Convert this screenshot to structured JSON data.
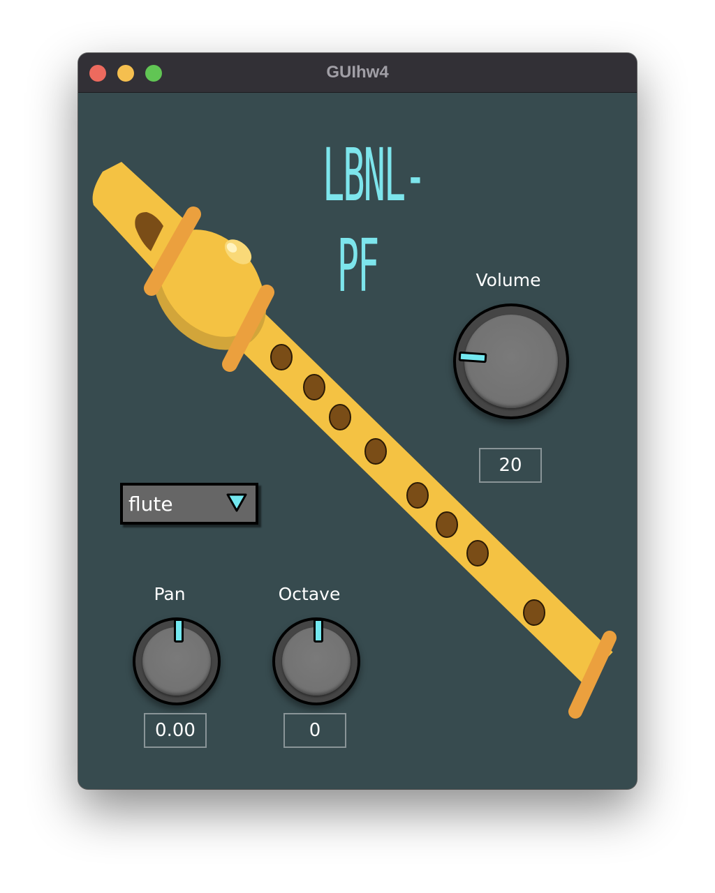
{
  "window": {
    "title": "GUIhw4"
  },
  "logo": {
    "text": "LBNL-PF",
    "color": "#7de5ec"
  },
  "instrument_select": {
    "selected": "flute",
    "icon": "triangle-down-icon"
  },
  "volume": {
    "label": "Volume",
    "value": "20"
  },
  "pan": {
    "label": "Pan",
    "value": "0.00"
  },
  "octave": {
    "label": "Octave",
    "value": "0"
  },
  "colors": {
    "background": "#374b4f",
    "accent": "#73e8f0",
    "recorder_body": "#f4c243",
    "recorder_ring": "#eba03e",
    "finger_hole": "#7a4d17"
  }
}
